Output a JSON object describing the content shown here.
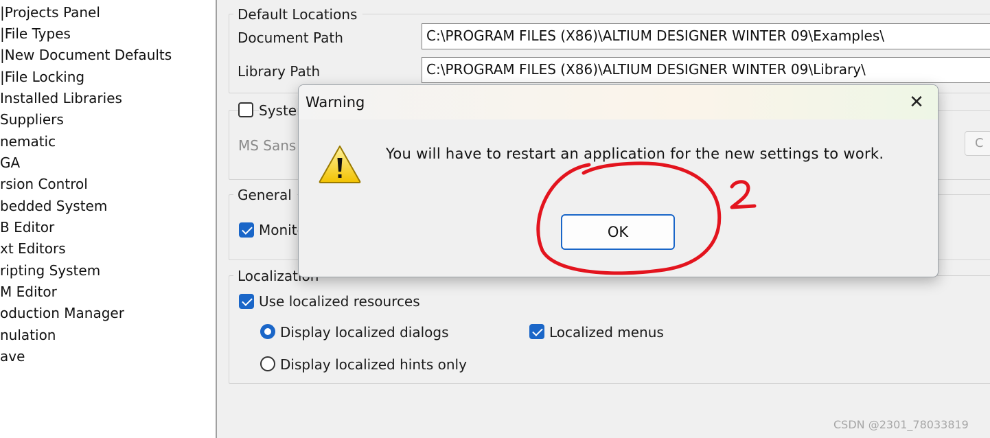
{
  "tree": {
    "items": [
      {
        "label": "|Projects Panel"
      },
      {
        "label": "|File Types"
      },
      {
        "label": "|New Document Defaults"
      },
      {
        "label": "|File Locking"
      },
      {
        "label": " Installed Libraries"
      },
      {
        "label": " Suppliers"
      },
      {
        "label": "nematic"
      },
      {
        "label": "GA"
      },
      {
        "label": "rsion Control"
      },
      {
        "label": "bedded System"
      },
      {
        "label": "B Editor"
      },
      {
        "label": "xt Editors"
      },
      {
        "label": "ripting System"
      },
      {
        "label": "M Editor"
      },
      {
        "label": "oduction Manager"
      },
      {
        "label": "nulation"
      },
      {
        "label": "ave"
      }
    ]
  },
  "default_locations": {
    "title": "Default Locations",
    "document_path_label": "Document Path",
    "document_path_value": "C:\\PROGRAM FILES (X86)\\ALTIUM DESIGNER WINTER 09\\Examples\\",
    "library_path_label": "Library Path",
    "library_path_value": "C:\\PROGRAM FILES (X86)\\ALTIUM DESIGNER WINTER 09\\Library\\"
  },
  "system_font": {
    "checkbox_label": "Syster",
    "font_name": "MS Sans",
    "edge_button_label": "C"
  },
  "general": {
    "title": "General",
    "monitor_label": "Monito"
  },
  "localization": {
    "title": "Localization",
    "use_localized_label": "Use localized resources",
    "display_dialogs_label": "Display localized dialogs",
    "localized_menus_label": "Localized menus",
    "display_hints_label": "Display localized hints only"
  },
  "dialog": {
    "title": "Warning",
    "close_glyph": "✕",
    "message": "You will have to restart an application for the new settings to work.",
    "ok_label": "OK",
    "icon": "warning-icon"
  },
  "annotation": {
    "number": "2",
    "color": "#e3141e"
  },
  "watermark": "CSDN @2301_78033819",
  "colors": {
    "accent": "#1a66c8",
    "panel": "#ffffff",
    "background": "#f0f0f0"
  }
}
